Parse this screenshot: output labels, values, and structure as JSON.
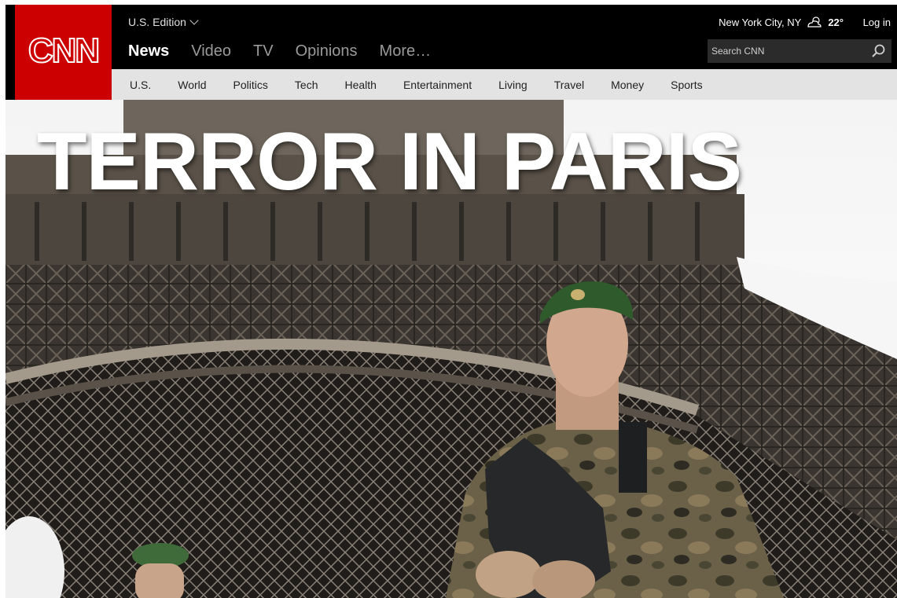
{
  "brand": {
    "logo_text": "CNN",
    "color": "#cc0000"
  },
  "edition": "U.S. Edition",
  "main_nav": [
    "News",
    "Video",
    "TV",
    "Opinions",
    "More…"
  ],
  "weather": {
    "location": "New York City, NY",
    "temp": "22°",
    "icon": "partly-cloudy-icon"
  },
  "login_label": "Log in",
  "search": {
    "placeholder": "Search CNN"
  },
  "sub_nav": [
    "U.S.",
    "World",
    "Politics",
    "Tech",
    "Health",
    "Entertainment",
    "Living",
    "Travel",
    "Money",
    "Sports"
  ],
  "hero": {
    "headline": "TERROR IN PARIS",
    "image_description_icon": "eiffel-tower-soldiers-photo"
  }
}
